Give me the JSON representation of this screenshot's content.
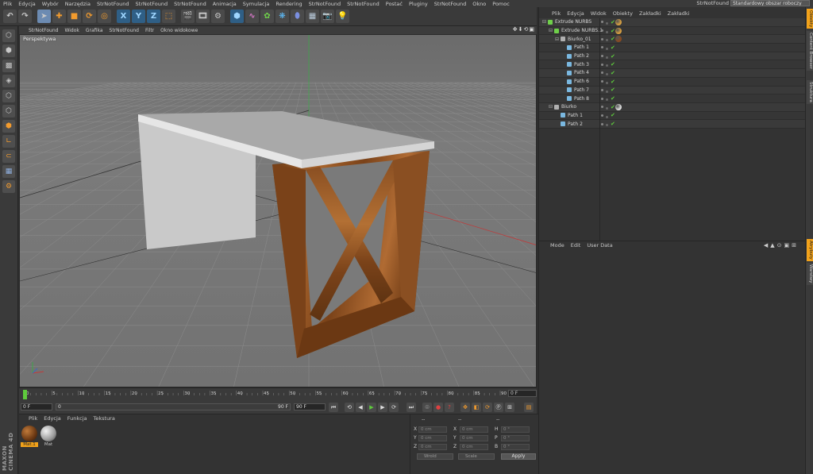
{
  "menubar": {
    "items": [
      "Plik",
      "Edycja",
      "Wybór",
      "Narzędzia",
      "StrNotFound",
      "StrNotFound",
      "StrNotFound",
      "Animacja",
      "Symulacja",
      "Rendering",
      "StrNotFound",
      "StrNotFound",
      "Postać",
      "Pluginy",
      "StrNotFound",
      "Okno",
      "Pomoc"
    ],
    "layout_label": "StrNotFound",
    "layout_value": "Standardowy obszar roboczy"
  },
  "viewport": {
    "menu": [
      "StrNotFound",
      "Widok",
      "Grafika",
      "StrNotFound",
      "Filtr",
      "Okno widokowe"
    ],
    "label": "Perspektywa",
    "icons": "✥⬇⟲▣"
  },
  "timeline": {
    "ticks": [
      "0",
      "5",
      "10",
      "15",
      "20",
      "25",
      "30",
      "35",
      "40",
      "45",
      "50",
      "55",
      "60",
      "65",
      "70",
      "75",
      "80",
      "85",
      "90"
    ],
    "current_frame": "0 F"
  },
  "transport": {
    "start": "0 F",
    "range_start": "0",
    "range_end": "90 F",
    "end": "90 F"
  },
  "materials": {
    "menu": [
      "Plik",
      "Edycja",
      "Funkcja",
      "Tekstura"
    ],
    "items": [
      {
        "name": "Mat.1",
        "selected": true
      },
      {
        "name": "Mat",
        "selected": false
      }
    ]
  },
  "coordinates": {
    "header_left": "--",
    "header_mid": "--",
    "header_right": "--",
    "rows": [
      {
        "a": "X",
        "av": "0 cm",
        "b": "X",
        "bv": "0 cm",
        "c": "H",
        "cv": "0 °"
      },
      {
        "a": "Y",
        "av": "0 cm",
        "b": "Y",
        "bv": "0 cm",
        "c": "P",
        "cv": "0 °"
      },
      {
        "a": "Z",
        "av": "0 cm",
        "b": "Z",
        "bv": "0 cm",
        "c": "B",
        "cv": "0 °"
      }
    ],
    "mode_select": "Wrold",
    "size_select": "Scale",
    "apply": "Apply"
  },
  "brand": "MAXON CINEMA 4D",
  "objects": {
    "menu": [
      "Plik",
      "Edycja",
      "Widok",
      "Obiekty",
      "Zakładki",
      "Zakładki"
    ],
    "rows": [
      {
        "name": "Extrude NURBS",
        "indent": 0,
        "icon": "#6fcf4a",
        "tag": "#d9a040"
      },
      {
        "name": "Extrude NURBS.1",
        "indent": 1,
        "icon": "#6fcf4a",
        "tag": "#d9a040"
      },
      {
        "name": "Biurko_01",
        "indent": 2,
        "icon": "#b0b0b0",
        "tag": "#8a4a20"
      },
      {
        "name": "Path 1",
        "indent": 3,
        "icon": "#7ab8e0",
        "tag": ""
      },
      {
        "name": "Path 2",
        "indent": 3,
        "icon": "#7ab8e0",
        "tag": ""
      },
      {
        "name": "Path 3",
        "indent": 3,
        "icon": "#7ab8e0",
        "tag": ""
      },
      {
        "name": "Path 4",
        "indent": 3,
        "icon": "#7ab8e0",
        "tag": ""
      },
      {
        "name": "Path 6",
        "indent": 3,
        "icon": "#7ab8e0",
        "tag": ""
      },
      {
        "name": "Path 7",
        "indent": 3,
        "icon": "#7ab8e0",
        "tag": ""
      },
      {
        "name": "Path 8",
        "indent": 3,
        "icon": "#7ab8e0",
        "tag": ""
      },
      {
        "name": "Biurko",
        "indent": 1,
        "icon": "#b0b0b0",
        "tag": "#dddddd"
      },
      {
        "name": "Path 1",
        "indent": 2,
        "icon": "#7ab8e0",
        "tag": ""
      },
      {
        "name": "Path 2",
        "indent": 2,
        "icon": "#7ab8e0",
        "tag": ""
      }
    ]
  },
  "attributes": {
    "menu": [
      "Mode",
      "Edit",
      "User Data"
    ],
    "icons": "◀▲⊙▣⊞"
  },
  "right_tabs": [
    {
      "label": "Obiekty",
      "active": true
    },
    {
      "label": "Content Browser",
      "active": false
    },
    {
      "label": "Struktura",
      "active": false
    },
    {
      "label": "Atrybuty",
      "active": true
    },
    {
      "label": "Warstwy",
      "active": false
    }
  ],
  "colors": {
    "accent": "#f2a21a",
    "wood": "#8a4f22",
    "table_top": "#b5b5b5",
    "grid": "#8a8a8a"
  }
}
